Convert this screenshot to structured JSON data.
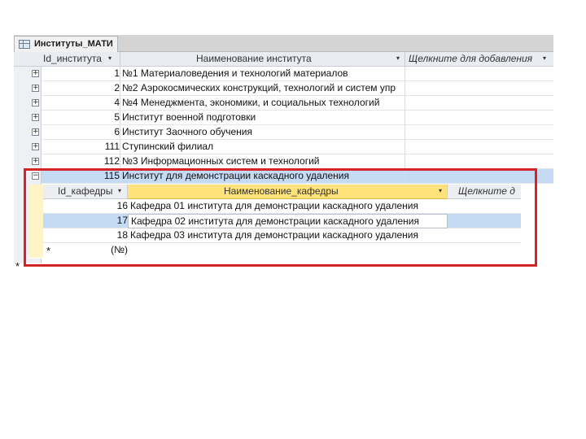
{
  "tab": {
    "title": "Институты_МАТИ"
  },
  "main_headers": {
    "id": "Id_института",
    "name": "Наименование института",
    "add": "Щелкните для добавления"
  },
  "institutes": [
    {
      "id": "1",
      "name": "№1 Материаловедения и технологий материалов"
    },
    {
      "id": "2",
      "name": "№2 Аэрокосмических конструкций, технологий и систем упр"
    },
    {
      "id": "4",
      "name": "№4 Менеджмента, экономики, и социальных технологий"
    },
    {
      "id": "5",
      "name": "Институт военной подготовки"
    },
    {
      "id": "6",
      "name": "Институт Заочного обучения"
    },
    {
      "id": "111",
      "name": "Ступинский филиал"
    },
    {
      "id": "112",
      "name": "№3 Информационных систем и технологий"
    },
    {
      "id": "115",
      "name": "Институт для демонстрации каскадного удаления"
    }
  ],
  "sub_headers": {
    "id": "Id_кафедры",
    "name": "Наименование_кафедры",
    "add": "Щелкните д"
  },
  "departments": [
    {
      "id": "16",
      "name": "Кафедра 01 института для демонстрации каскадного удаления"
    },
    {
      "id": "17",
      "name": "Кафедра 02 института для демонстрации каскадного удаления"
    },
    {
      "id": "18",
      "name": "Кафедра 03 института для демонстрации каскадного удаления"
    }
  ],
  "new_record": {
    "marker": "*",
    "placeholder": "(№)"
  },
  "glyphs": {
    "expand": "+",
    "collapse": "−",
    "sort_arrow": "▾"
  },
  "colors": {
    "highlight_box": "#d42424",
    "current_row": "#c5daf3",
    "active_header": "#ffe27a"
  }
}
